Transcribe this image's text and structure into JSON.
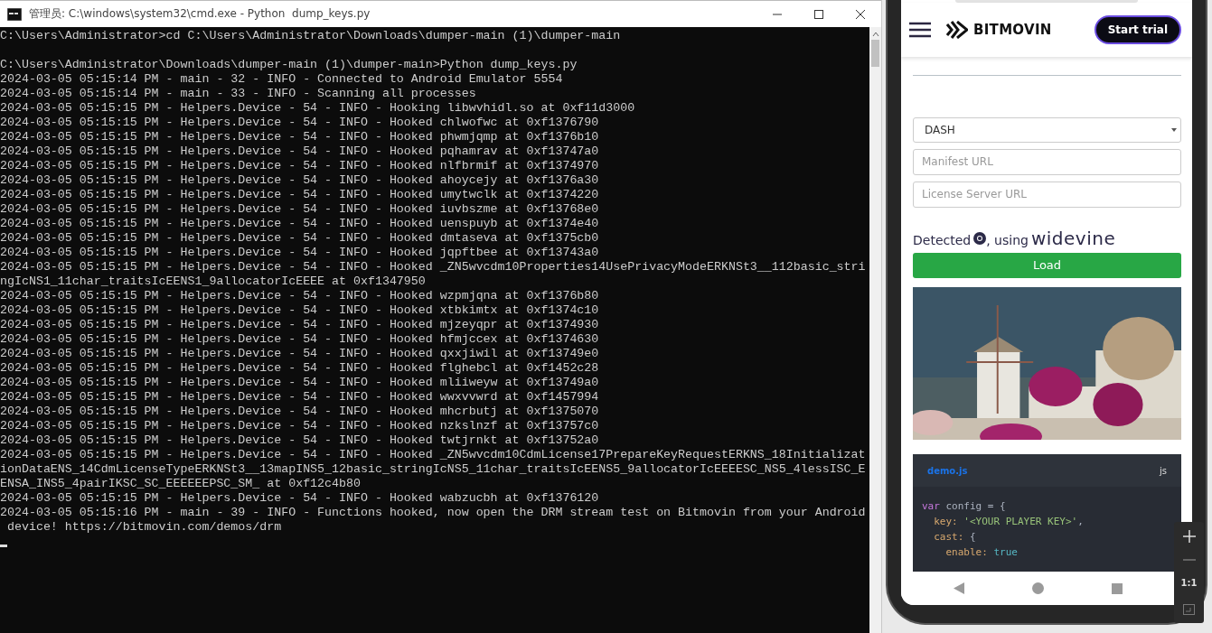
{
  "window": {
    "title": "管理员: C:\\windows\\system32\\cmd.exe - Python  dump_keys.py"
  },
  "console": {
    "blocks": [
      [
        "C:\\Users\\Administrator>cd C:\\Users\\Administrator\\Downloads\\dumper-main (1)\\dumper-main"
      ],
      [
        "C:\\Users\\Administrator\\Downloads\\dumper-main (1)\\dumper-main>Python dump_keys.py",
        "2024-03-05 05:15:14 PM - main - 32 - INFO - Connected to Android Emulator 5554",
        "2024-03-05 05:15:14 PM - main - 33 - INFO - Scanning all processes",
        "2024-03-05 05:15:15 PM - Helpers.Device - 54 - INFO - Hooking libwvhidl.so at 0xf11d3000",
        "2024-03-05 05:15:15 PM - Helpers.Device - 54 - INFO - Hooked chlwofwc at 0xf1376790",
        "2024-03-05 05:15:15 PM - Helpers.Device - 54 - INFO - Hooked phwmjqmp at 0xf1376b10",
        "2024-03-05 05:15:15 PM - Helpers.Device - 54 - INFO - Hooked pqhamrav at 0xf13747a0",
        "2024-03-05 05:15:15 PM - Helpers.Device - 54 - INFO - Hooked nlfbrmif at 0xf1374970",
        "2024-03-05 05:15:15 PM - Helpers.Device - 54 - INFO - Hooked ahoycejy at 0xf1376a30",
        "2024-03-05 05:15:15 PM - Helpers.Device - 54 - INFO - Hooked umytwclk at 0xf1374220",
        "2024-03-05 05:15:15 PM - Helpers.Device - 54 - INFO - Hooked iuvbszme at 0xf13768e0",
        "2024-03-05 05:15:15 PM - Helpers.Device - 54 - INFO - Hooked uenspuyb at 0xf1374e40",
        "2024-03-05 05:15:15 PM - Helpers.Device - 54 - INFO - Hooked dmtaseva at 0xf1375cb0",
        "2024-03-05 05:15:15 PM - Helpers.Device - 54 - INFO - Hooked jqpftbee at 0xf13743a0",
        "2024-03-05 05:15:15 PM - Helpers.Device - 54 - INFO - Hooked _ZN5wvcdm10Properties14UsePrivacyModeERKNSt3__112basic_stri",
        "ngIcNS1_11char_traitsIcEENS1_9allocatorIcEEEE at 0xf1347950",
        "2024-03-05 05:15:15 PM - Helpers.Device - 54 - INFO - Hooked wzpmjqna at 0xf1376b80",
        "2024-03-05 05:15:15 PM - Helpers.Device - 54 - INFO - Hooked xtbkimtx at 0xf1374c10",
        "2024-03-05 05:15:15 PM - Helpers.Device - 54 - INFO - Hooked mjzeyqpr at 0xf1374930",
        "2024-03-05 05:15:15 PM - Helpers.Device - 54 - INFO - Hooked hfmjccex at 0xf1374630",
        "2024-03-05 05:15:15 PM - Helpers.Device - 54 - INFO - Hooked qxxjiwil at 0xf13749e0",
        "2024-03-05 05:15:15 PM - Helpers.Device - 54 - INFO - Hooked flghebcl at 0xf1452c28",
        "2024-03-05 05:15:15 PM - Helpers.Device - 54 - INFO - Hooked mliiweyw at 0xf13749a0",
        "2024-03-05 05:15:15 PM - Helpers.Device - 54 - INFO - Hooked wwxvvwrd at 0xf1457994",
        "2024-03-05 05:15:15 PM - Helpers.Device - 54 - INFO - Hooked mhcrbutj at 0xf1375070",
        "2024-03-05 05:15:15 PM - Helpers.Device - 54 - INFO - Hooked nzkslnzf at 0xf13757c0",
        "2024-03-05 05:15:15 PM - Helpers.Device - 54 - INFO - Hooked twtjrnkt at 0xf13752a0",
        "2024-03-05 05:15:15 PM - Helpers.Device - 54 - INFO - Hooked _ZN5wvcdm10CdmLicense17PrepareKeyRequestERKNS_18Initializat",
        "ionDataENS_14CdmLicenseTypeERKNSt3__13mapINS5_12basic_stringIcNS5_11char_traitsIcEENS5_9allocatorIcEEEESC_NS5_4lessISC_E",
        "ENSA_INS5_4pairIKSC_SC_EEEEEEPSC_SM_ at 0xf12c4b80",
        "2024-03-05 05:15:15 PM - Helpers.Device - 54 - INFO - Hooked wabzucbh at 0xf1376120",
        "2024-03-05 05:15:16 PM - main - 39 - INFO - Functions hooked, now open the DRM stream test on Bitmovin from your Android",
        " device! https://bitmovin.com/demos/drm"
      ]
    ]
  },
  "phone": {
    "header": {
      "brand": "BITMOVIN",
      "button": "Start trial"
    },
    "form": {
      "stream_type": "DASH",
      "manifest": {
        "placeholder": "Manifest URL"
      },
      "license": {
        "placeholder": "License Server URL"
      }
    },
    "detection": {
      "prefix": "Detected",
      "middle": ", using",
      "drm": "widevine"
    },
    "load_button": "Load",
    "code": {
      "filename": "demo.js",
      "language": "js",
      "lines": [
        [
          {
            "kind": "keyword",
            "text": "var"
          },
          {
            "kind": "plain",
            "text": " config = {"
          }
        ],
        [
          {
            "kind": "property",
            "text": "  key: "
          },
          {
            "kind": "string",
            "text": "'<YOUR PLAYER KEY>'"
          },
          {
            "kind": "plain",
            "text": ","
          }
        ],
        [
          {
            "kind": "property",
            "text": "  cast:"
          },
          {
            "kind": "plain",
            "text": " {"
          }
        ],
        [
          {
            "kind": "property",
            "text": "    enable: "
          },
          {
            "kind": "literal",
            "text": "true"
          }
        ]
      ]
    }
  },
  "emulator_toolbar": {
    "zoom_label": "1:1"
  }
}
